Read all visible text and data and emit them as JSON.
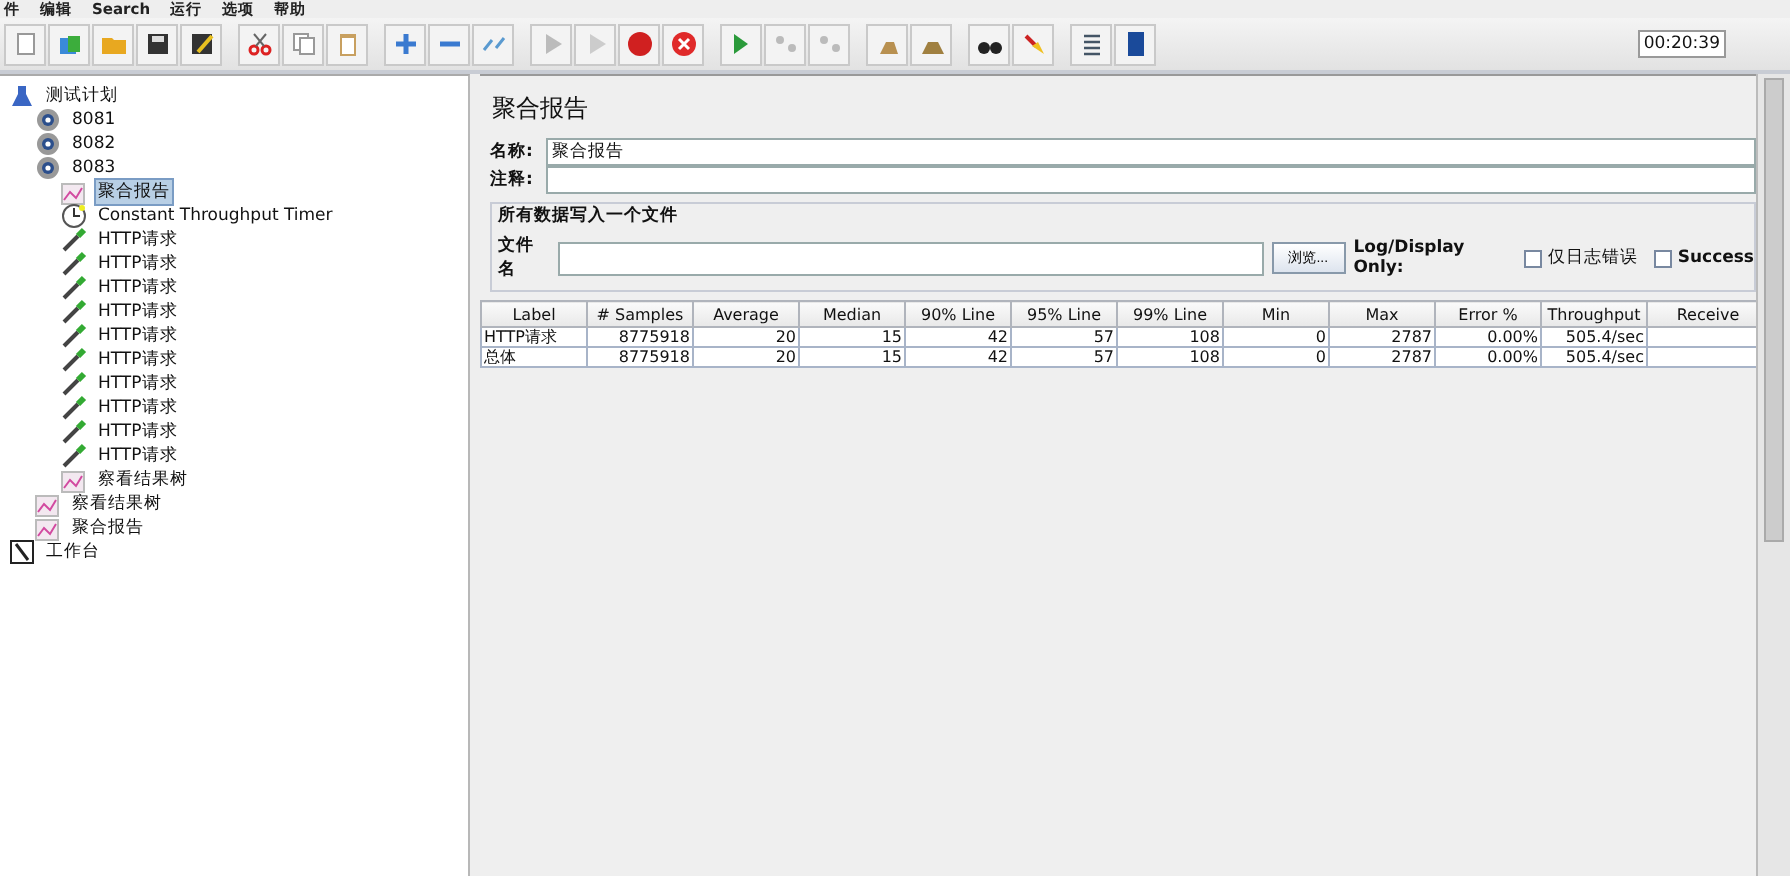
{
  "menu": [
    "件",
    "编辑",
    "Search",
    "运行",
    "选项",
    "帮助"
  ],
  "timer": "00:20:39",
  "tree": [
    {
      "label": "测试计划",
      "kind": "plan",
      "selected": false,
      "children": [
        {
          "label": "8081",
          "kind": "group",
          "selected": false
        },
        {
          "label": "8082",
          "kind": "group",
          "selected": false
        },
        {
          "label": "8083",
          "kind": "group",
          "selected": false,
          "children": [
            {
              "label": "聚合报告",
              "kind": "listener",
              "selected": true
            },
            {
              "label": "Constant Throughput Timer",
              "kind": "timer",
              "selected": false
            },
            {
              "label": "HTTP请求",
              "kind": "sampler",
              "selected": false
            },
            {
              "label": "HTTP请求",
              "kind": "sampler",
              "selected": false
            },
            {
              "label": "HTTP请求",
              "kind": "sampler",
              "selected": false
            },
            {
              "label": "HTTP请求",
              "kind": "sampler",
              "selected": false
            },
            {
              "label": "HTTP请求",
              "kind": "sampler",
              "selected": false
            },
            {
              "label": "HTTP请求",
              "kind": "sampler",
              "selected": false
            },
            {
              "label": "HTTP请求",
              "kind": "sampler",
              "selected": false
            },
            {
              "label": "HTTP请求",
              "kind": "sampler",
              "selected": false
            },
            {
              "label": "HTTP请求",
              "kind": "sampler",
              "selected": false
            },
            {
              "label": "HTTP请求",
              "kind": "sampler",
              "selected": false
            },
            {
              "label": "察看结果树",
              "kind": "listener",
              "selected": false
            }
          ]
        },
        {
          "label": "察看结果树",
          "kind": "listener",
          "selected": false
        },
        {
          "label": "聚合报告",
          "kind": "listener",
          "selected": false
        }
      ]
    },
    {
      "label": "工作台",
      "kind": "workbench",
      "selected": false
    }
  ],
  "panel": {
    "title": "聚合报告",
    "name_label": "名称:",
    "name_value": "聚合报告",
    "comment_label": "注释:",
    "file_group": "所有数据写入一个文件",
    "file_label": "文件名",
    "browse": "浏览...",
    "log_only": "Log/Display Only:",
    "checkboxes": [
      {
        "label": "仅日志错误",
        "checked": false
      },
      {
        "label": "Success",
        "checked": false
      }
    ]
  },
  "table": {
    "columns": [
      "Label",
      "# Samples",
      "Average",
      "Median",
      "90% Line",
      "95% Line",
      "99% Line",
      "Min",
      "Max",
      "Error %",
      "Throughput",
      "Receive"
    ],
    "rows": [
      [
        "HTTP请求",
        "8775918",
        "20",
        "15",
        "42",
        "57",
        "108",
        "0",
        "2787",
        "0.00%",
        "505.4/sec",
        ""
      ],
      [
        "总体",
        "8775918",
        "20",
        "15",
        "42",
        "57",
        "108",
        "0",
        "2787",
        "0.00%",
        "505.4/sec",
        ""
      ]
    ]
  }
}
